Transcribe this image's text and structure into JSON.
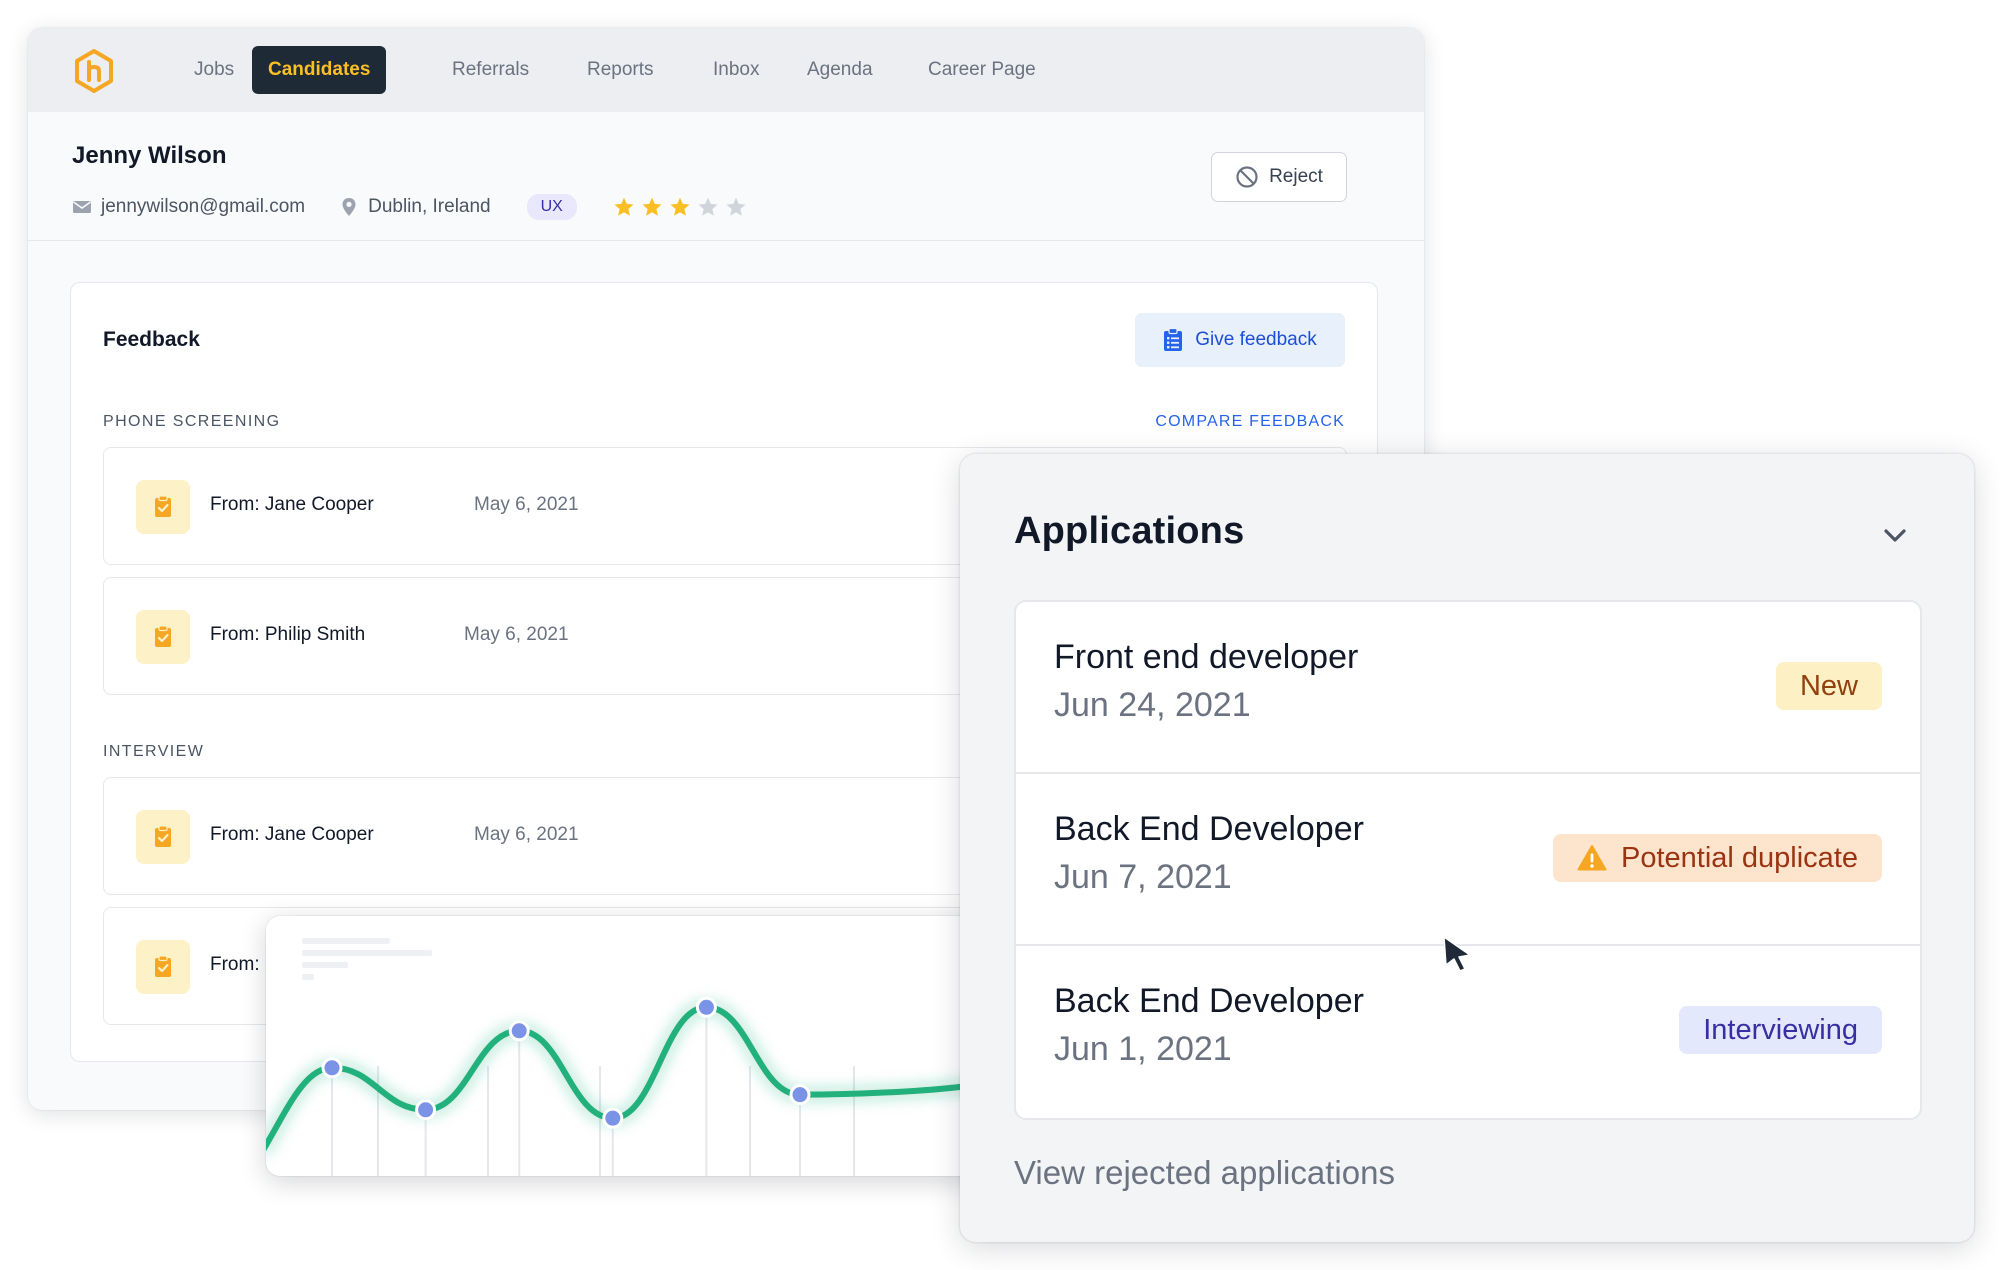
{
  "nav": {
    "items": [
      {
        "label": "Jobs"
      },
      {
        "label": "Candidates"
      },
      {
        "label": "Referrals"
      },
      {
        "label": "Reports"
      },
      {
        "label": "Inbox"
      },
      {
        "label": "Agenda"
      },
      {
        "label": "Career Page"
      }
    ],
    "active": "Candidates"
  },
  "candidate": {
    "name": "Jenny Wilson",
    "email": "jennywilson@gmail.com",
    "location": "Dublin, Ireland",
    "tag": "UX",
    "rating": 3,
    "rating_max": 5,
    "reject_label": "Reject"
  },
  "feedback": {
    "title": "Feedback",
    "give_label": "Give feedback",
    "compare_label": "COMPARE FEEDBACK",
    "sections": [
      {
        "label": "PHONE SCREENING",
        "entries": [
          {
            "from": "From: Jane Cooper",
            "date": "May 6, 2021"
          },
          {
            "from": "From: Philip Smith",
            "date": "May 6, 2021"
          }
        ]
      },
      {
        "label": "INTERVIEW",
        "entries": [
          {
            "from": "From: Jane Cooper",
            "date": "May 6, 2021"
          },
          {
            "from": "From:",
            "date": ""
          }
        ]
      }
    ]
  },
  "applications": {
    "title": "Applications",
    "items": [
      {
        "title": "Front end developer",
        "date": "Jun 24, 2021",
        "status": "New"
      },
      {
        "title": "Back End Developer",
        "date": "Jun 7, 2021",
        "status": "Potential duplicate"
      },
      {
        "title": "Back End Developer",
        "date": "Jun 1, 2021",
        "status": "Interviewing"
      }
    ],
    "view_rejected_label": "View rejected applications"
  },
  "chart_data": {
    "type": "line",
    "x": [
      1,
      2,
      3,
      4,
      5,
      6
    ],
    "series": [
      {
        "values": [
          43,
          18,
          65,
          13,
          79,
          27
        ]
      }
    ],
    "ylim": [
      0,
      100
    ],
    "grid": false,
    "line_color": "#22b07d",
    "marker_color": "#7b93e6"
  },
  "colors": {
    "brand": "#f5a623",
    "nav_active_bg": "#1f2a37",
    "nav_active_text": "#fbbf24",
    "link_blue": "#2563eb"
  }
}
